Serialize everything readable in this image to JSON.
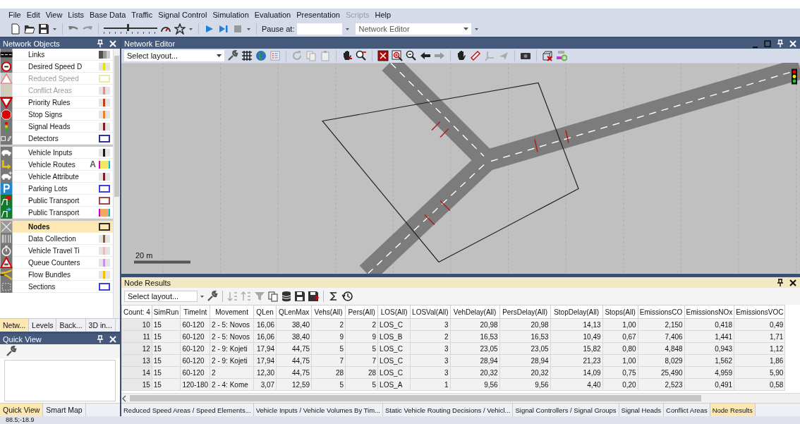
{
  "menu": [
    {
      "label": "File",
      "disabled": false
    },
    {
      "label": "Edit",
      "disabled": false
    },
    {
      "label": "View",
      "disabled": false
    },
    {
      "label": "Lists",
      "disabled": false
    },
    {
      "label": "Base Data",
      "disabled": false
    },
    {
      "label": "Traffic",
      "disabled": false
    },
    {
      "label": "Signal Control",
      "disabled": false
    },
    {
      "label": "Simulation",
      "disabled": false
    },
    {
      "label": "Evaluation",
      "disabled": false
    },
    {
      "label": "Presentation",
      "disabled": false
    },
    {
      "label": "Scripts",
      "disabled": true
    },
    {
      "label": "Help",
      "disabled": false
    }
  ],
  "toolbar": {
    "speed_slider": {
      "level": 0.45
    },
    "pause_label": "Pause at:",
    "view_select": "Network Editor"
  },
  "network_objects": {
    "title": "Network Objects",
    "groups": [
      {
        "items": [
          {
            "label": "Links",
            "kind": "gradient",
            "color": "#505050",
            "disabled": false,
            "selected": false
          },
          {
            "label": "Desired Speed D",
            "kind": "stripe",
            "color": "#f0e000",
            "disabled": false,
            "selected": false
          },
          {
            "label": "Reduced Speed",
            "kind": "box",
            "color": "#eee8a0",
            "disabled": true,
            "selected": false
          },
          {
            "label": "Conflict Areas",
            "kind": "stripe",
            "color": "#e09090",
            "disabled": true,
            "selected": false
          },
          {
            "label": "Priority Rules",
            "kind": "stripe",
            "color": "#c04010",
            "disabled": false,
            "selected": false
          },
          {
            "label": "Stop Signs",
            "kind": "stripe",
            "color": "#f08020",
            "disabled": false,
            "selected": false
          },
          {
            "label": "Signal Heads",
            "kind": "stripe",
            "color": "#802020",
            "disabled": false,
            "selected": false
          },
          {
            "label": "Detectors",
            "kind": "box",
            "color": "#3030a0",
            "disabled": false,
            "selected": false
          }
        ]
      },
      {
        "items": [
          {
            "label": "Vehicle Inputs",
            "kind": "stripe",
            "color": "#181818",
            "disabled": false,
            "selected": false
          },
          {
            "label": "Vehicle Routes",
            "kind": "fill",
            "color": "#f0e860",
            "marker": "A",
            "disabled": false,
            "selected": false
          },
          {
            "label": "Vehicle Attribute",
            "kind": "stripe",
            "color": "#802020",
            "disabled": false,
            "selected": false
          },
          {
            "label": "Parking Lots",
            "kind": "box",
            "color": "#4040e0",
            "disabled": false,
            "selected": false
          },
          {
            "label": "Public Transport",
            "kind": "box",
            "color": "#a04848",
            "disabled": false,
            "selected": false
          },
          {
            "label": "Public Transport",
            "kind": "fill",
            "color": "#f4a868",
            "disabled": false,
            "selected": false
          }
        ]
      },
      {
        "items": [
          {
            "label": "Nodes",
            "kind": "box",
            "color": "#303030",
            "disabled": false,
            "selected": true
          },
          {
            "label": "Data Collection",
            "kind": "stripe",
            "color": "#806040",
            "disabled": false,
            "selected": false
          },
          {
            "label": "Vehicle Travel Ti",
            "kind": "stripe",
            "color": "#f0b8b8",
            "disabled": false,
            "selected": false
          },
          {
            "label": "Queue Counters",
            "kind": "stripe",
            "color": "#c890e8",
            "disabled": false,
            "selected": false
          },
          {
            "label": "Flow Bundles",
            "kind": "stripe",
            "color": "#f0c000",
            "disabled": false,
            "selected": false
          },
          {
            "label": "Sections",
            "kind": "box",
            "color": "#4040e0",
            "disabled": false,
            "selected": false
          }
        ]
      }
    ],
    "tabs": [
      {
        "label": "Netw...",
        "selected": true
      },
      {
        "label": "Levels",
        "selected": false
      },
      {
        "label": "Back...",
        "selected": false
      },
      {
        "label": "3D in...",
        "selected": false
      }
    ]
  },
  "quick_view": {
    "title": "Quick View",
    "tabs": [
      {
        "label": "Quick View",
        "selected": true
      },
      {
        "label": "Smart Map",
        "selected": false
      }
    ]
  },
  "network_editor": {
    "title": "Network Editor",
    "layout_select": "Select layout...",
    "scale_label": "20 m"
  },
  "node_results": {
    "title": "Node Results",
    "layout_select": "Select layout...",
    "table": {
      "columns": [
        "Count: 4",
        "SimRun",
        "TimeInt",
        "Movement",
        "QLen",
        "QLenMax",
        "Vehs(All)",
        "Pers(All)",
        "LOS(All)",
        "LOSVal(All)",
        "VehDelay(All)",
        "PersDelay(All)",
        "StopDelay(All)",
        "Stops(All)",
        "EmissionsCO",
        "EmissionsNOx",
        "EmissionsVOC"
      ],
      "rows": [
        [
          "10",
          "15",
          "60-120",
          "2 - 5: Novos",
          "16,06",
          "38,40",
          "2",
          "2",
          "LOS_C",
          "3",
          "20,98",
          "20,98",
          "14,13",
          "1,00",
          "2,150",
          "0,418",
          "0,49"
        ],
        [
          "11",
          "15",
          "60-120",
          "2 - 5: Novos",
          "16,06",
          "38,40",
          "9",
          "9",
          "LOS_B",
          "2",
          "16,53",
          "16,53",
          "10,49",
          "0,67",
          "7,406",
          "1,441",
          "1,71"
        ],
        [
          "12",
          "15",
          "60-120",
          "2 - 9: Kojeti",
          "17,94",
          "44,75",
          "5",
          "5",
          "LOS_C",
          "3",
          "23,05",
          "23,05",
          "15,82",
          "0,80",
          "4,848",
          "0,943",
          "1,12"
        ],
        [
          "13",
          "15",
          "60-120",
          "2 - 9: Kojeti",
          "17,94",
          "44,75",
          "7",
          "7",
          "LOS_C",
          "3",
          "28,94",
          "28,94",
          "21,23",
          "1,00",
          "8,029",
          "1,562",
          "1,86"
        ],
        [
          "14",
          "15",
          "60-120",
          "2",
          "12,30",
          "44,75",
          "28",
          "28",
          "LOS_C",
          "3",
          "20,32",
          "20,32",
          "14,09",
          "0,75",
          "25,490",
          "4,959",
          "5,90"
        ],
        [
          "15",
          "15",
          "120-180",
          "2 - 4: Kome",
          "3,07",
          "12,59",
          "5",
          "5",
          "LOS_A",
          "1",
          "9,56",
          "9,56",
          "4,40",
          "0,20",
          "2,523",
          "0,491",
          "0,58"
        ]
      ]
    }
  },
  "bottom_tabs": [
    {
      "label": "Reduced Speed Areas / Speed Elements...",
      "selected": false
    },
    {
      "label": "Vehicle Inputs / Vehicle Volumes By Tim...",
      "selected": false
    },
    {
      "label": "Static Vehicle Routing Decisions / Vehicl...",
      "selected": false
    },
    {
      "label": "Signal Controllers / Signal Groups",
      "selected": false
    },
    {
      "label": "Signal Heads",
      "selected": false
    },
    {
      "label": "Conflict Areas",
      "selected": false
    },
    {
      "label": "Node Results",
      "selected": true
    }
  ],
  "status_bar": "88.5;-18.9"
}
